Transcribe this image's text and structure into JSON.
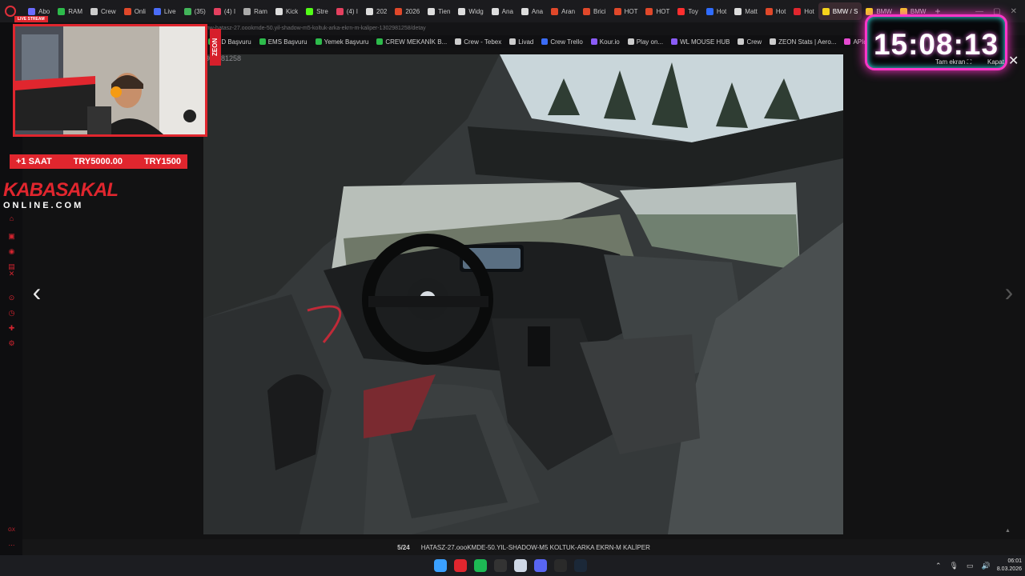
{
  "browser": {
    "tabs": [
      {
        "label": "Abo",
        "color": "#6b6bff"
      },
      {
        "label": "RAM",
        "color": "#2dbb4b"
      },
      {
        "label": "Crew",
        "color": "#cccccc"
      },
      {
        "label": "Onli",
        "color": "#e0482a"
      },
      {
        "label": "Live",
        "color": "#4a6cf7"
      },
      {
        "label": "(35)",
        "color": "#42b55a"
      },
      {
        "label": "(4) I",
        "color": "#e4405f"
      },
      {
        "label": "Ram",
        "color": "#aaaaaa"
      },
      {
        "label": "Kick",
        "color": "#dddddd"
      },
      {
        "label": "Stre",
        "color": "#53fc18"
      },
      {
        "label": "(4) I",
        "color": "#e4405f"
      },
      {
        "label": "202",
        "color": "#dddddd"
      },
      {
        "label": "2026",
        "color": "#e0482a"
      },
      {
        "label": "Tien",
        "color": "#dddddd"
      },
      {
        "label": "Widg",
        "color": "#dddddd"
      },
      {
        "label": "Ana",
        "color": "#dddddd"
      },
      {
        "label": "Ana",
        "color": "#dddddd"
      },
      {
        "label": "Aran",
        "color": "#e0482a"
      },
      {
        "label": "Brici",
        "color": "#e0482a"
      },
      {
        "label": "HOT",
        "color": "#e0482a"
      },
      {
        "label": "HOT",
        "color": "#e0482a"
      },
      {
        "label": "Toy",
        "color": "#ff2f2f"
      },
      {
        "label": "Hot",
        "color": "#2f6cff"
      },
      {
        "label": "Matt",
        "color": "#dddddd"
      },
      {
        "label": "Hot",
        "color": "#e0482a"
      },
      {
        "label": "Hot",
        "color": "#e0262e"
      },
      {
        "label": "BMW / S",
        "color": "#f5d21b",
        "active": true
      },
      {
        "label": "BMW",
        "color": "#f5d21b"
      },
      {
        "label": "BMW",
        "color": "#f5d21b"
      }
    ],
    "new_tab": "+",
    "address": "www.sahibinden.com/ilan/vasita-otomobil-bmw-hatasz-27.oookmde-50.yil-shadow-m5-koltuk-arka-ekrn-m-kaliper-1302981258/detay",
    "bookmarks": [
      {
        "label": "PD Başvuru",
        "color": "#2dbb4b"
      },
      {
        "label": "EMS Başvuru",
        "color": "#2dbb4b"
      },
      {
        "label": "Yemek Başvuru",
        "color": "#2dbb4b"
      },
      {
        "label": "CREW MEKANİK B...",
        "color": "#2dbb4b"
      },
      {
        "label": "Crew - Tebex",
        "color": "#cccccc"
      },
      {
        "label": "Livad",
        "color": "#cccccc"
      },
      {
        "label": "Crew Trello",
        "color": "#3b6cf6"
      },
      {
        "label": "Kour.io",
        "color": "#8a5cf6"
      },
      {
        "label": "Play on...",
        "color": "#cccccc"
      },
      {
        "label": "WL MOUSE HUB",
        "color": "#8a5cf6"
      },
      {
        "label": "Crew",
        "color": "#cccccc"
      },
      {
        "label": "ZEON Stats | Aero...",
        "color": "#cccccc"
      },
      {
        "label": "APIq",
        "color": "#e44ad0"
      }
    ]
  },
  "listing": {
    "id_fragment": "302981258",
    "counter": "5/24",
    "caption": "HATASZ-27.oooKMDE-50.YIL-SHADOW-M5 KOLTUK-ARKA EKRN-M KALİPER",
    "prev": "‹",
    "next": "›",
    "scroll_top": "▲"
  },
  "overlay": {
    "live_tag": "LIVE STREAM",
    "zeon": "ZEON",
    "donate": {
      "duration": "+1 SAAT",
      "amount1": "TRY5000.00",
      "amount2": "TRY1500"
    },
    "brand_top": "KABASAKAL",
    "brand_bottom": "ONLINE.COM",
    "clock": {
      "time": "15:08:13",
      "fullscreen": "Tam ekran",
      "close_label": "Kapat",
      "close_icon": "✕"
    }
  },
  "sidebar_badge": "GX",
  "taskbar": {
    "time": "06:01",
    "date": "8.03.2026",
    "apps": [
      {
        "name": "windows-start-icon",
        "color": "#3aa0ff"
      },
      {
        "name": "opera-gx-icon",
        "color": "#e0262e"
      },
      {
        "name": "spotify-icon",
        "color": "#1db954"
      },
      {
        "name": "obs-icon",
        "color": "#333333"
      },
      {
        "name": "notepad-icon",
        "color": "#cfd8e6"
      },
      {
        "name": "discord-icon",
        "color": "#5865f2"
      },
      {
        "name": "epic-games-icon",
        "color": "#2a2a2a"
      },
      {
        "name": "steam-icon",
        "color": "#1b2838"
      }
    ]
  }
}
